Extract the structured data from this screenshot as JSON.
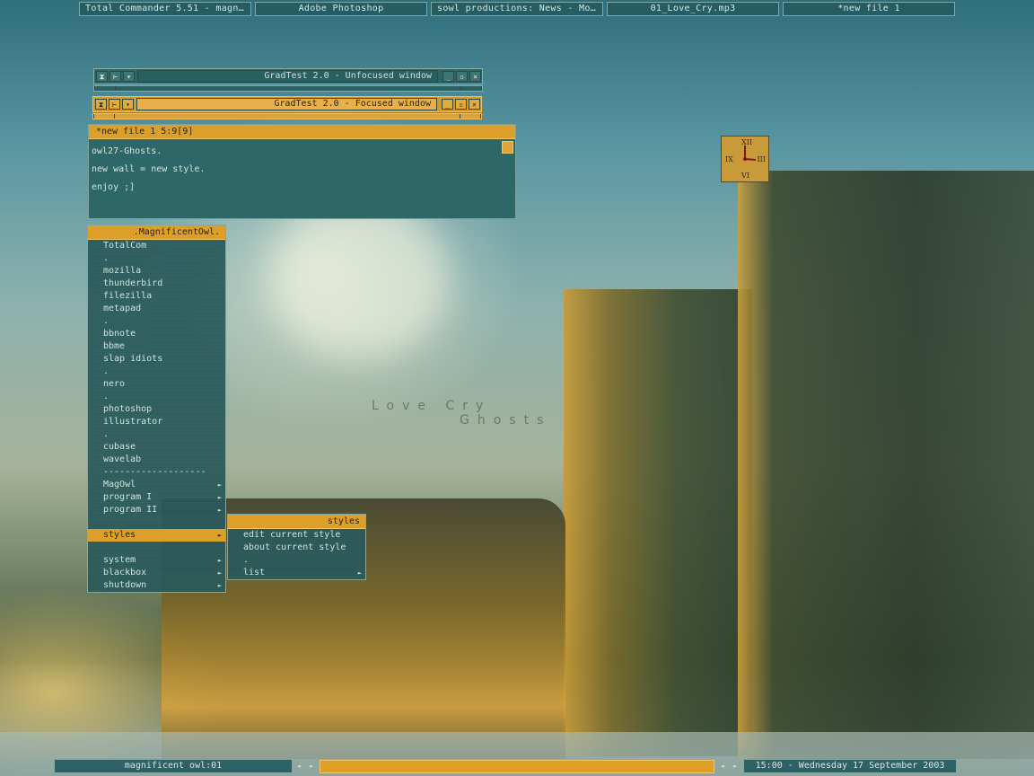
{
  "taskbar_top": {
    "tasks": [
      "Total Commander 5.51 - magni...",
      "Adobe Photoshop",
      "sowl productions: News - Moz...",
      "01_Love_Cry.mp3",
      "*new file 1"
    ]
  },
  "windows": {
    "unfocused": {
      "title": "GradTest 2.0 - Unfocused window"
    },
    "focused": {
      "title": "GradTest 2.0 - Focused window"
    }
  },
  "editor": {
    "title": "*new file 1   5:9[9]",
    "lines": [
      "owl27-Ghosts.",
      "new wall = new style.",
      "enjoy ;]"
    ]
  },
  "clock_numerals": {
    "top": "XII",
    "right": "III",
    "bottom": "VI",
    "left": "IX"
  },
  "menu": {
    "title": ".MagnificentOwl.",
    "items": [
      {
        "label": "TotalCom"
      },
      {
        "label": "."
      },
      {
        "label": "mozilla"
      },
      {
        "label": "thunderbird"
      },
      {
        "label": "filezilla"
      },
      {
        "label": "metapad"
      },
      {
        "label": "."
      },
      {
        "label": "bbnote"
      },
      {
        "label": "bbme"
      },
      {
        "label": "slap idiots"
      },
      {
        "label": "."
      },
      {
        "label": "nero"
      },
      {
        "label": "."
      },
      {
        "label": "photoshop"
      },
      {
        "label": "illustrator"
      },
      {
        "label": "."
      },
      {
        "label": "cubase"
      },
      {
        "label": "wavelab"
      },
      {
        "label": "-------------------"
      },
      {
        "label": "MagOwl",
        "submenu": true
      },
      {
        "label": "program I",
        "submenu": true
      },
      {
        "label": "program II",
        "submenu": true
      },
      {
        "label": ""
      },
      {
        "label": "styles",
        "submenu": true,
        "selected": true
      },
      {
        "label": ""
      },
      {
        "label": "system",
        "submenu": true
      },
      {
        "label": "blackbox",
        "submenu": true
      },
      {
        "label": "shutdown",
        "submenu": true
      }
    ]
  },
  "submenu": {
    "title": "styles",
    "items": [
      {
        "label": "edit current style"
      },
      {
        "label": "about current style"
      },
      {
        "label": "."
      },
      {
        "label": "list",
        "submenu": true
      }
    ]
  },
  "wallpaper_text": {
    "line1": "Love Cry",
    "line2": "Ghosts"
  },
  "bottombar": {
    "workspace": "magnificent owl:01",
    "clock": "15:00 - Wednesday 17 September 2003"
  },
  "icons": {
    "submenu_arrow": "►",
    "prev": "◄",
    "next": "►"
  },
  "colors": {
    "accent": "#dc9f2a",
    "panel": "#2e6767",
    "border": "#7fa9a3"
  }
}
